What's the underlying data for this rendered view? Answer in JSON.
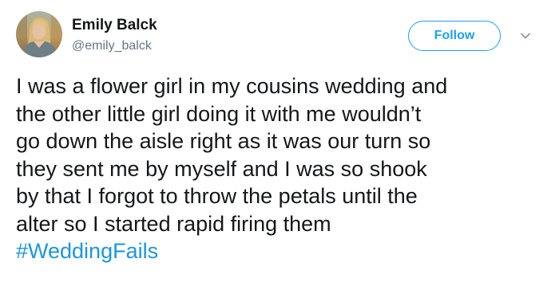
{
  "tweet": {
    "author": {
      "display_name": "Emily Balck",
      "handle": "@emily_balck"
    },
    "follow_label": "Follow",
    "text_lines": [
      "I was a flower girl in my cousins wedding and",
      "the other little girl doing it with me wouldn’t",
      "go down the aisle right as it was our turn so",
      "they sent me by myself and I was so shook",
      "by that I forgot to throw the petals until the",
      "alter so I started rapid firing them"
    ],
    "hashtag": "#WeddingFails"
  },
  "icons": {
    "avatar": "profile-photo",
    "caret": "chevron-down-icon"
  },
  "colors": {
    "brand_blue": "#1da1f2",
    "hashtag_blue": "#1b95e0",
    "text_primary": "#14171a",
    "text_secondary": "#657786"
  }
}
